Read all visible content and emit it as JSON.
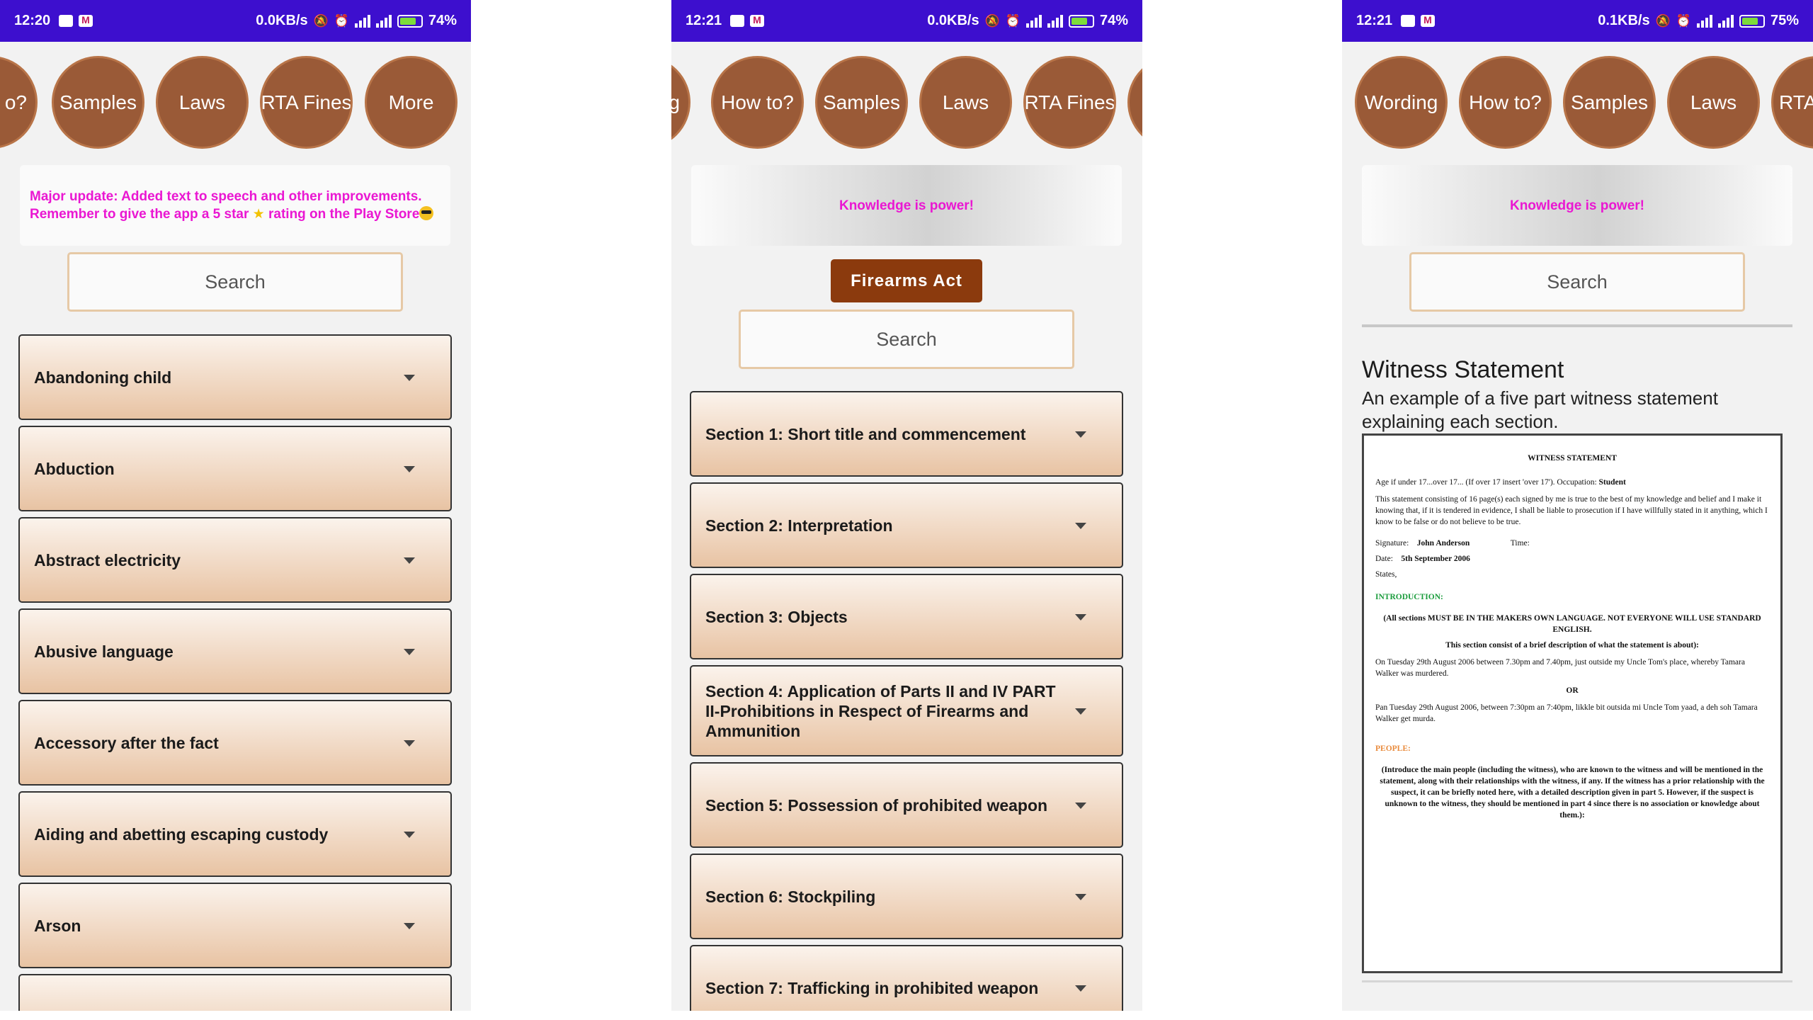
{
  "phones": [
    {
      "status": {
        "time": "12:20",
        "speed": "0.0KB/s",
        "net": "4G",
        "battery": "74"
      },
      "nav": [
        "o?",
        "Samples",
        "Laws",
        "RTA Fines",
        "More"
      ],
      "banner": [
        "Major update: Added text to speech and other improvements.",
        "Remember to give the app a 5 star",
        "rating on the Play Store"
      ],
      "search_placeholder": "Search",
      "items": [
        "Abandoning child",
        "Abduction",
        "Abstract electricity",
        "Abusive language",
        "Accessory after the fact",
        "Aiding and abetting escaping custody",
        "Arson"
      ]
    },
    {
      "status": {
        "time": "12:21",
        "speed": "0.0KB/s",
        "net": "4G",
        "battery": "74"
      },
      "nav": [
        "g",
        "How to?",
        "Samples",
        "Laws",
        "RTA Fines"
      ],
      "banner": "Knowledge is power!",
      "act_button": "Firearms Act",
      "search_placeholder": "Search",
      "items": [
        "Section 1: Short title and commencement",
        "Section 2: Interpretation",
        "Section 3: Objects",
        "Section 4: Application of Parts II and IV PART II-Prohibitions in Respect of Firearms and Ammunition",
        "Section 5: Possession of prohibited weapon",
        "Section 6: Stockpiling",
        "Section 7: Trafficking in prohibited weapon"
      ]
    },
    {
      "status": {
        "time": "12:21",
        "speed": "0.1KB/s",
        "net": "4G",
        "battery": "75"
      },
      "nav": [
        "Wording",
        "How to?",
        "Samples",
        "Laws",
        "RTA"
      ],
      "banner": "Knowledge is power!",
      "search_placeholder": "Search",
      "title": "Witness Statement",
      "description": "An example of a five part witness statement explaining each section.",
      "doc": {
        "heading": "WITNESS STATEMENT",
        "age_line": "Age if under 17...over 17... (If over 17 insert 'over 17'). Occupation:",
        "occupation": "Student",
        "declaration": "This statement consisting of 16 page(s) each signed by me is true to the best of my knowledge and belief and I make it knowing that, if it is tendered in evidence, I shall be liable to prosecution if I have willfully stated in it anything, which I know to be false or do not believe to be true.",
        "signature_label": "Signature:",
        "signature": "John Anderson",
        "time_label": "Time:",
        "date_label": "Date:",
        "date": "5th September 2006",
        "states": "States,",
        "intro_heading": "INTRODUCTION:",
        "intro_rule": "(All sections MUST BE IN THE MAKERS OWN LANGUAGE. NOT EVERYONE WILL USE STANDARD ENGLISH.",
        "intro_sub": "This section consist of a brief description of what the statement is about):",
        "example1": "On Tuesday 29th August 2006 between 7.30pm and 7.40pm, just outside my Uncle Tom's place, whereby Tamara Walker was murdered.",
        "or": "OR",
        "example2": "Pan Tuesday 29th August 2006, between 7:30pm an 7:40pm, likkle bit outsida mi Uncle Tom yaad, a deh soh Tamara Walker get murda.",
        "people_heading": "PEOPLE:",
        "people_text": "(Introduce the main people (including the witness), who are known to the witness and will be mentioned in the statement, along with their relationships with the witness, if any. If the witness has a prior relationship with the suspect, it can be briefly noted here, with a detailed description given in part 5. However, if the suspect is unknown to the witness, they should be mentioned in part 4 since there is no association or knowledge about them.):"
      }
    }
  ]
}
